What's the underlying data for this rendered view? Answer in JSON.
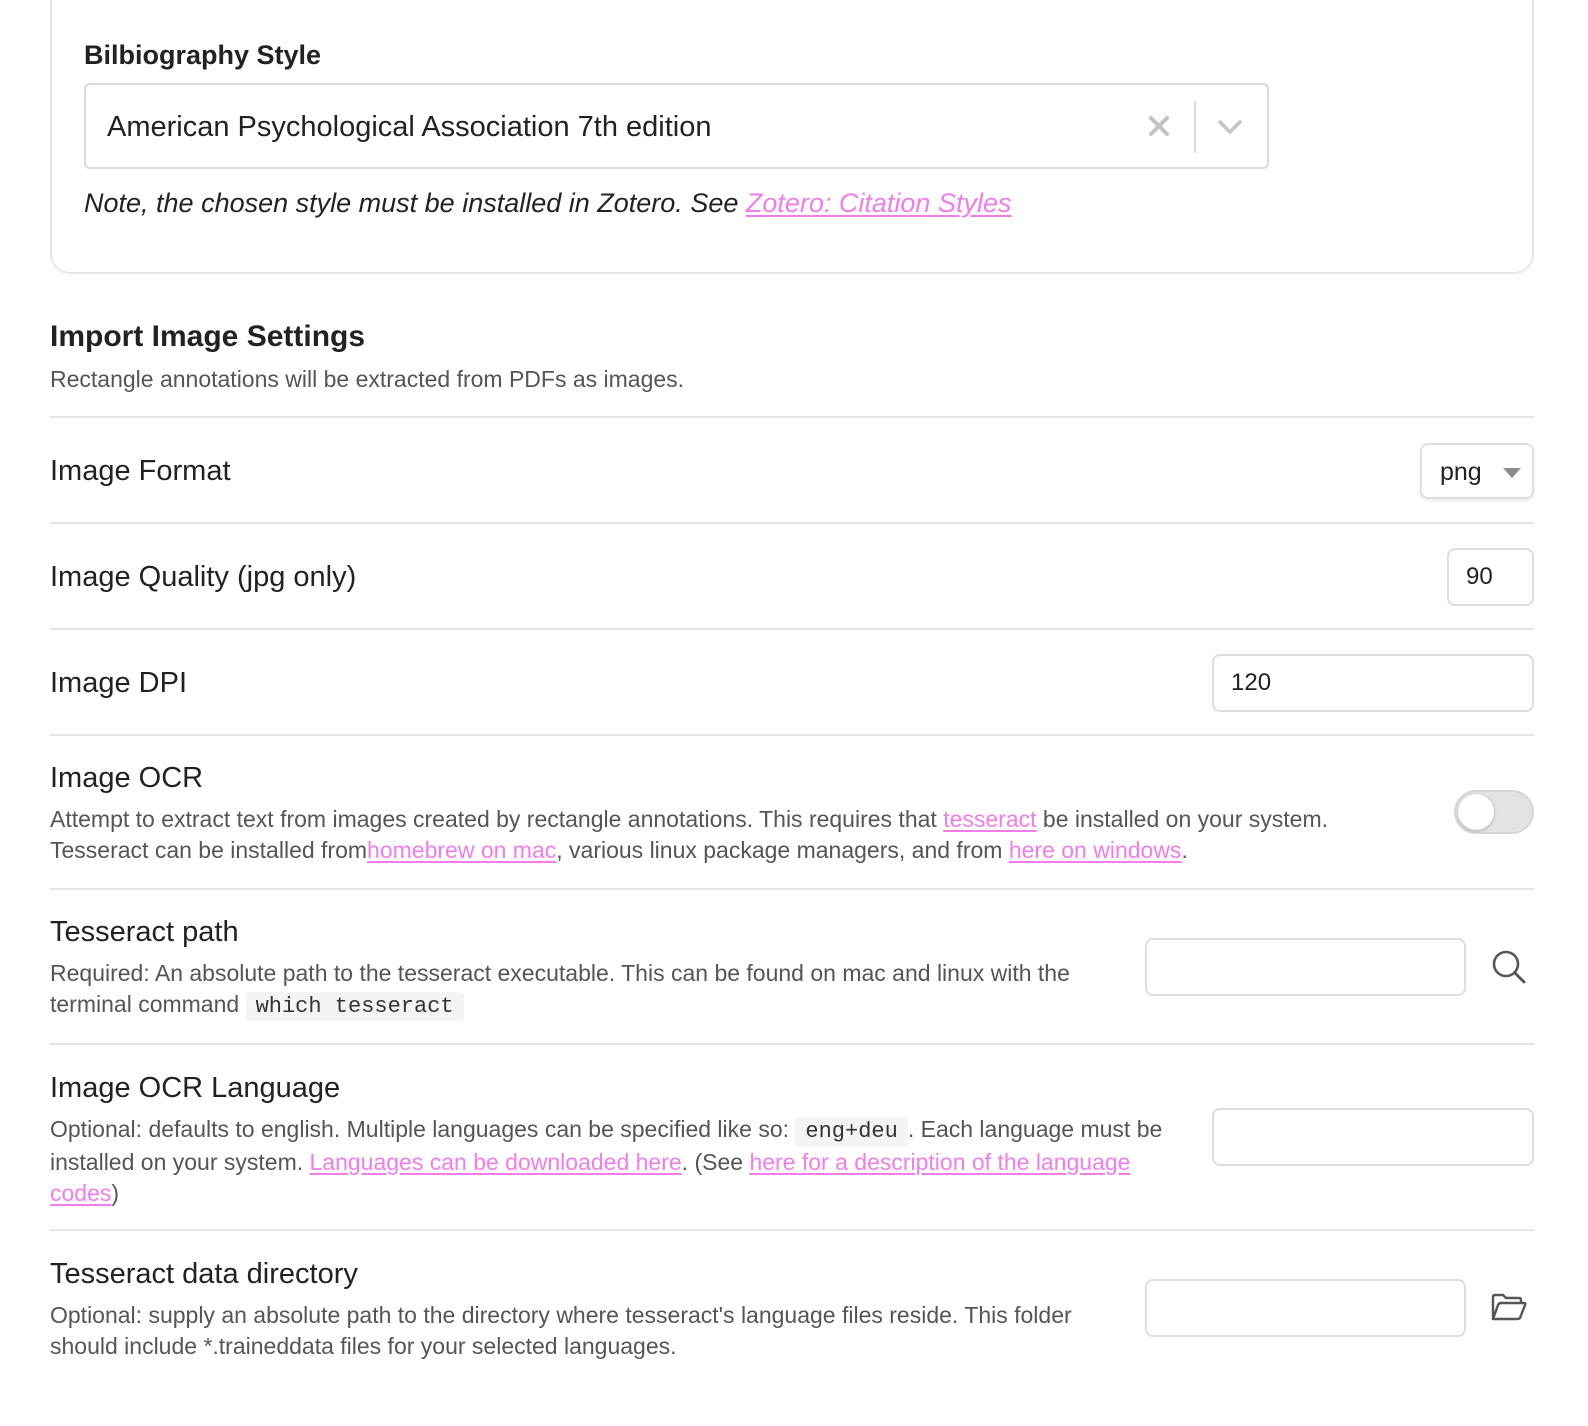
{
  "bibliography": {
    "title": "Bilbiography Style",
    "selected_value": "American Psychological Association 7th edition",
    "note_text": "Note, the chosen style must be installed in Zotero. See ",
    "note_link": "Zotero: Citation Styles"
  },
  "section": {
    "title": "Import Image Settings",
    "description": "Rectangle annotations will be extracted from PDFs as images."
  },
  "image_format": {
    "label": "Image Format",
    "value": "png"
  },
  "image_quality": {
    "label": "Image Quality (jpg only)",
    "value": "90"
  },
  "image_dpi": {
    "label": "Image DPI",
    "value": "120"
  },
  "image_ocr": {
    "label": "Image OCR",
    "desc_1": "Attempt to extract text from images created by rectangle annotations. This requires that ",
    "link_1": "tesseract",
    "desc_2": " be installed on your system. Tesseract can be installed from",
    "link_2": "homebrew on mac",
    "desc_3": ", various linux package managers, and from ",
    "link_3": "here on windows",
    "desc_4": ".",
    "enabled": false
  },
  "tesseract_path": {
    "label": "Tesseract path",
    "desc_1": "Required: An absolute path to the tesseract executable. This can be found on mac and linux with the terminal command ",
    "code": "which tesseract",
    "value": ""
  },
  "ocr_language": {
    "label": "Image OCR Language",
    "desc_1": "Optional: defaults to english. Multiple languages can be specified like so: ",
    "code": "eng+deu",
    "desc_2": ". Each language must be installed on your system. ",
    "link_1": "Languages can be downloaded here",
    "desc_3": ". (See ",
    "link_2": "here for a description of the language codes",
    "desc_4": ")",
    "value": ""
  },
  "tesseract_data_dir": {
    "label": "Tesseract data directory",
    "desc": "Optional: supply an absolute path to the directory where tesseract's language files reside. This folder should include *.traineddata files for your selected languages.",
    "value": ""
  },
  "colors": {
    "link": "#f27de9",
    "text": "#222222",
    "muted_text": "#555555",
    "border": "#e6e6e6"
  },
  "icons": [
    "close-icon",
    "chevron-down-icon",
    "caret-down-icon",
    "search-icon",
    "folder-open-icon"
  ]
}
